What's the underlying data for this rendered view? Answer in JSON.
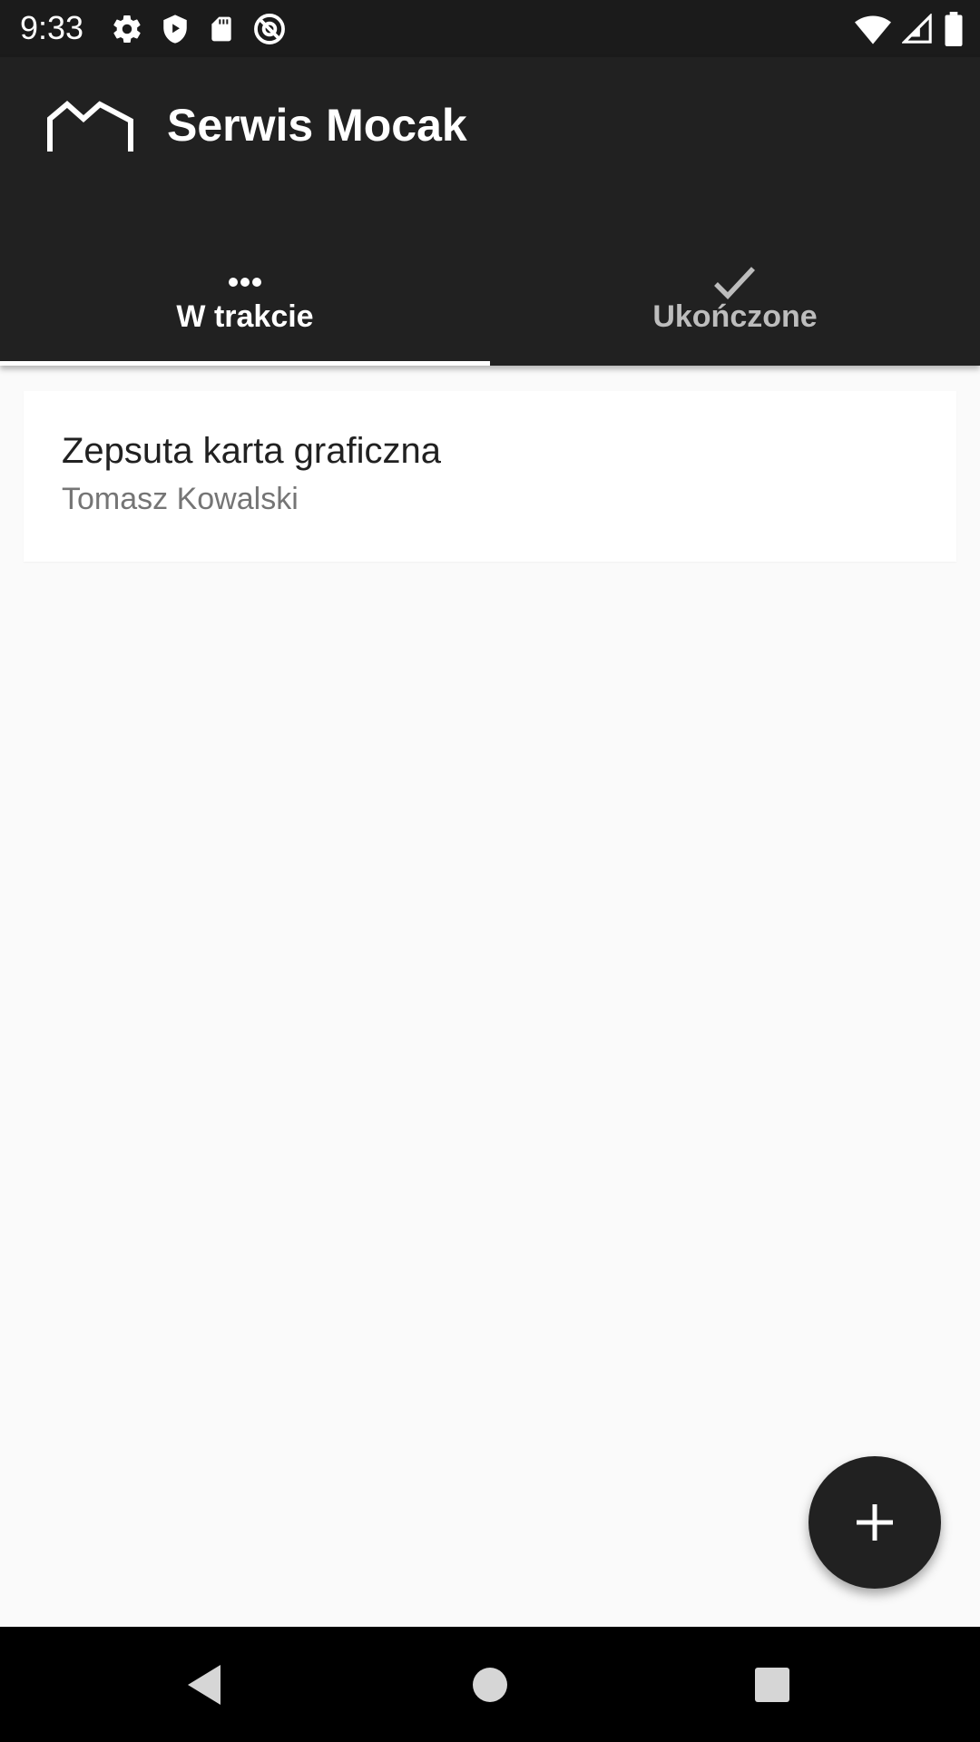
{
  "status_bar": {
    "time": "9:33",
    "left_icons": [
      "settings-icon",
      "shield-play-icon",
      "sd-card-icon",
      "at-sign-icon"
    ],
    "right_icons": [
      "wifi-icon",
      "cellular-signal-icon",
      "battery-icon"
    ]
  },
  "app_bar": {
    "title": "Serwis Mocak",
    "logo_icon": "crown-outline-logo"
  },
  "tabs": [
    {
      "label": "W trakcie",
      "icon": "more-horizontal-icon",
      "active": true
    },
    {
      "label": "Ukończone",
      "icon": "check-icon",
      "active": false
    }
  ],
  "list": {
    "items": [
      {
        "title": "Zepsuta karta graficzna",
        "subtitle": "Tomasz Kowalski"
      }
    ]
  },
  "fab": {
    "icon": "plus-icon"
  },
  "nav_bar": {
    "buttons": [
      "back-icon",
      "home-icon",
      "recents-icon"
    ]
  },
  "colors": {
    "app_bar": "#212121",
    "status_bar": "#1b1b1b",
    "background": "#fafafa",
    "card": "#ffffff",
    "tab_active_text": "#ffffff",
    "tab_inactive_text": "#bdbdbd",
    "fab": "#212121",
    "nav_bar": "#000000"
  }
}
